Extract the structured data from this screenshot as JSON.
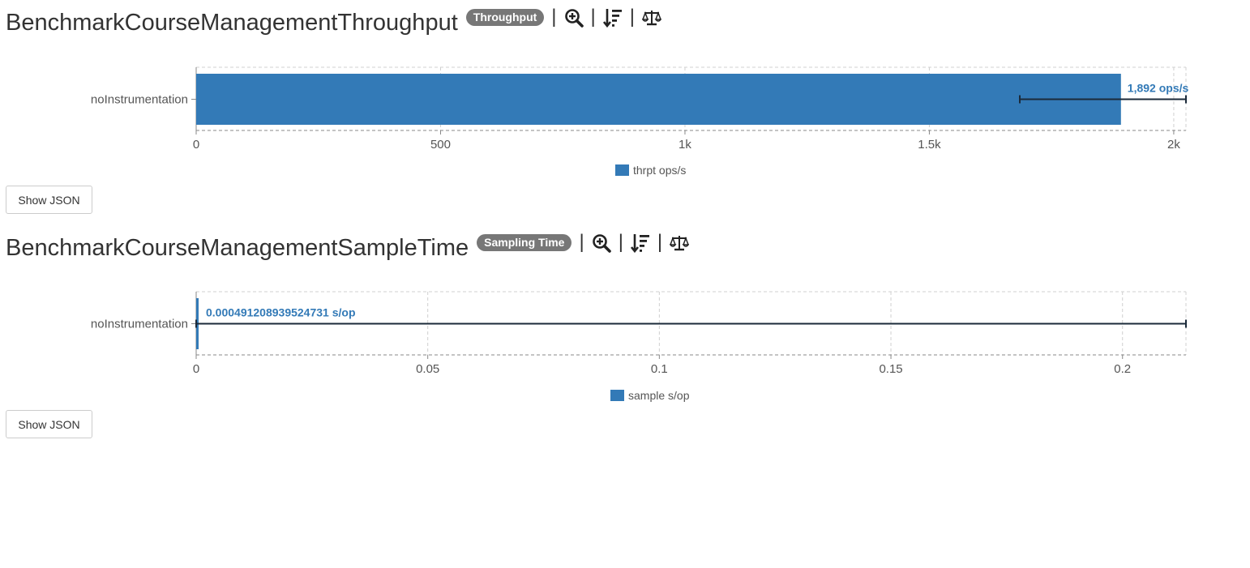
{
  "benchmarks": [
    {
      "title": "BenchmarkCourseManagementThroughput",
      "badge": "Throughput",
      "separator": "|",
      "tools": [
        "zoom-in-icon",
        "sort-descending-icon",
        "balance-scale-icon"
      ],
      "button_label": "Show JSON",
      "chart_data": {
        "type": "bar",
        "orientation": "horizontal",
        "categories": [
          "noInstrumentation"
        ],
        "series": [
          {
            "name": "thrpt ops/s",
            "values": [
              1892
            ]
          }
        ],
        "error_bars": [
          {
            "low": 1685,
            "high": 2025
          }
        ],
        "data_labels": [
          "1,892 ops/s"
        ],
        "xlim": [
          0,
          2025
        ],
        "xticks": [
          0,
          500,
          1000,
          1500,
          2000
        ],
        "xtick_labels": [
          "0",
          "500",
          "1k",
          "1.5k",
          "2k"
        ],
        "grid": true,
        "legend": "bottom-center",
        "color": "#337ab7"
      }
    },
    {
      "title": "BenchmarkCourseManagementSampleTime",
      "badge": "Sampling Time",
      "separator": "|",
      "tools": [
        "zoom-in-icon",
        "sort-descending-icon",
        "balance-scale-icon"
      ],
      "button_label": "Show JSON",
      "chart_data": {
        "type": "bar",
        "orientation": "horizontal",
        "categories": [
          "noInstrumentation"
        ],
        "series": [
          {
            "name": "sample s/op",
            "values": [
              0.000491208939524731
            ]
          }
        ],
        "error_bars": [
          {
            "low": 0,
            "high": 0.2137
          }
        ],
        "data_labels": [
          "0.000491208939524731 s/op"
        ],
        "xlim": [
          0,
          0.2137
        ],
        "xticks": [
          0,
          0.05,
          0.1,
          0.15,
          0.2
        ],
        "xtick_labels": [
          "0",
          "0.05",
          "0.1",
          "0.15",
          "0.2"
        ],
        "grid": true,
        "legend": "bottom-center",
        "color": "#337ab7"
      }
    }
  ]
}
